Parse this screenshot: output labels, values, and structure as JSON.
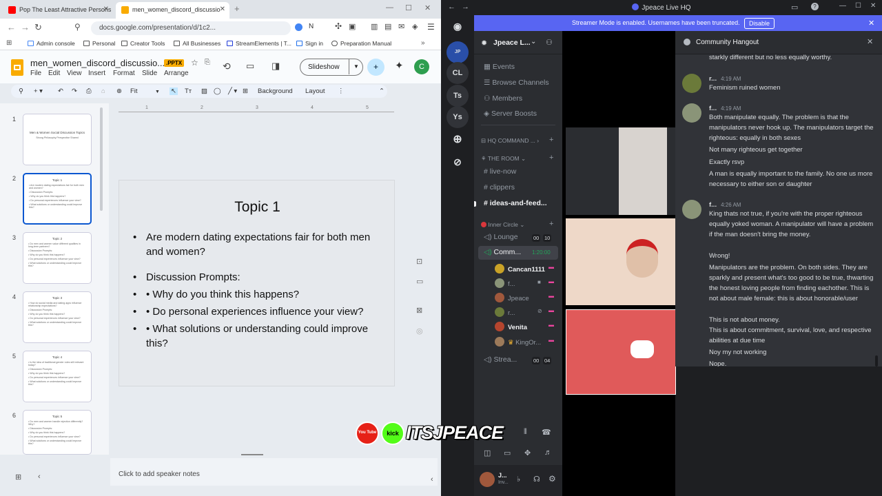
{
  "browser": {
    "tabs": [
      {
        "title": "Pop The Least Attractive Persons Bo",
        "icon_color": "#ff0000"
      },
      {
        "title": "men_women_discord_discussio",
        "icon_color": "#f9ab00"
      }
    ],
    "url": "docs.google.com/presentation/d/1c2...",
    "bookmarks": [
      "Admin console",
      "Personal",
      "Creator Tools",
      "All Businesses",
      "StreamElements | T...",
      "Sign in",
      "Preparation Manual"
    ]
  },
  "slides": {
    "doc_title": "men_women_discord_discussio...",
    "format_badge": ".PPTX",
    "menus": [
      "File",
      "Edit",
      "View",
      "Insert",
      "Format",
      "Slide",
      "Arrange"
    ],
    "slideshow_label": "Slideshow",
    "avatar_letter": "C",
    "toolbar": {
      "zoom": "Fit",
      "background": "Background",
      "layout": "Layout"
    },
    "thumbnails": [
      {
        "num": "1",
        "title": "Men & Women Social Discussion Topics",
        "lines": [
          "Strong Philosophy Perspective Shared"
        ]
      },
      {
        "num": "2",
        "title": "Topic 1",
        "lines": [
          "• Are modern dating expectations fair for both men and women?",
          "• Discussion Prompts:",
          "• Why do you think this happens?",
          "• Do personal experiences influence your view?",
          "• What solutions or understanding could improve this?"
        ]
      },
      {
        "num": "3",
        "title": "Topic 2",
        "lines": [
          "• Do men and women value different qualities in long-term partners?",
          "• Discussion Prompts:",
          "• Why do you think this happens?",
          "• Do personal experiences influence your view?",
          "• What solutions or understanding could improve this?"
        ]
      },
      {
        "num": "4",
        "title": "Topic 3",
        "lines": [
          "• How do social media and dating apps influence relationship expectations?",
          "• Discussion Prompts:",
          "• Why do you think this happens?",
          "• Do personal experiences influence your view?",
          "• What solutions or understanding could improve this?"
        ]
      },
      {
        "num": "5",
        "title": "Topic 4",
        "lines": [
          "• Is the idea of traditional gender roles still relevant today?",
          "• Discussion Prompts:",
          "• Why do you think this happens?",
          "• Do personal experiences influence your view?",
          "• What solutions or understanding could improve this?"
        ]
      },
      {
        "num": "6",
        "title": "Topic 5",
        "lines": [
          "• Do men and women handle rejection differently? Why?",
          "• Discussion Prompts:",
          "• Why do you think this happens?",
          "• Do personal experiences influence your view?",
          "• What solutions or understanding could improve this?"
        ]
      }
    ],
    "current_slide": {
      "title": "Topic 1",
      "bullets": [
        "Are modern dating expectations fair for both men and women?",
        "Discussion Prompts:",
        "• Why do you think this happens?",
        "• Do personal experiences influence your view?",
        "• What solutions or understanding could improve this?"
      ]
    },
    "notes_placeholder": "Click to add speaker notes"
  },
  "discord": {
    "window_title": "Jpeace Live HQ",
    "banner_text": "Streamer Mode is enabled. Usernames have been truncated.",
    "banner_button": "Disable",
    "servers": [
      "CL",
      "Ts",
      "Ys"
    ],
    "server_name": "Jpeace L...",
    "nav": [
      "Events",
      "Browse Channels",
      "Members",
      "Server Boosts"
    ],
    "categories": [
      "HQ COMMAND ...",
      "THE ROOM",
      "Inner Circle"
    ],
    "text_channels": [
      "live-now",
      "clippers",
      "ideas-and-feed..."
    ],
    "voice_channels": [
      {
        "name": "Lounge",
        "count_a": "00",
        "count_b": "10"
      },
      {
        "name": "Comm...",
        "timer": "1:20:00"
      },
      {
        "name": "Strea...",
        "count_a": "00",
        "count_b": "04"
      }
    ],
    "voice_users": [
      "Cancan1111",
      "f...",
      "Jpeace",
      "r...",
      "Venita",
      "KingOr..."
    ],
    "self_user": {
      "name": "J...",
      "status": "Inv..."
    },
    "thread_title": "Community Hangout",
    "messages": [
      {
        "lines": [
          "starkly different but no less equally worthy."
        ]
      },
      {
        "author": "r...",
        "time": "4:19 AM",
        "avatar_color": "#6b7a3a",
        "lines": [
          "Feminism ruined women"
        ]
      },
      {
        "author": "f...",
        "time": "4:19 AM",
        "avatar_color": "#8a9478",
        "lines": [
          "Both manipulate equally. The problem is that the manipulators never hook up. The manipulators target the righteous: equally in both sexes",
          "Not many righteous get together",
          "Exactly rsvp",
          "A man is equally important to the family. No one us more necessary to either son or daughter"
        ]
      },
      {
        "author": "f...",
        "time": "4:26 AM",
        "avatar_color": "#8a9478",
        "lines": [
          "King thats not true, if you're with the proper righteous equally yoked woman. A manipulator will have a problem if the man doesn't bring the money.",
          "Wrong!",
          "Manipulators are the problem. On both sides. They are sparkly and present what's too good to be true, thwarting the honest loving people from finding eachother. This is not about male female: this is about honorable/user",
          "This is not about money.\nThis is about commitment,  survival, love, and respective abilities at due time",
          "Noy my not working",
          "Nope."
        ]
      }
    ]
  },
  "overlay": {
    "youtube": "You Tube",
    "kick": "kick",
    "handle": "ITSJPEACE"
  }
}
